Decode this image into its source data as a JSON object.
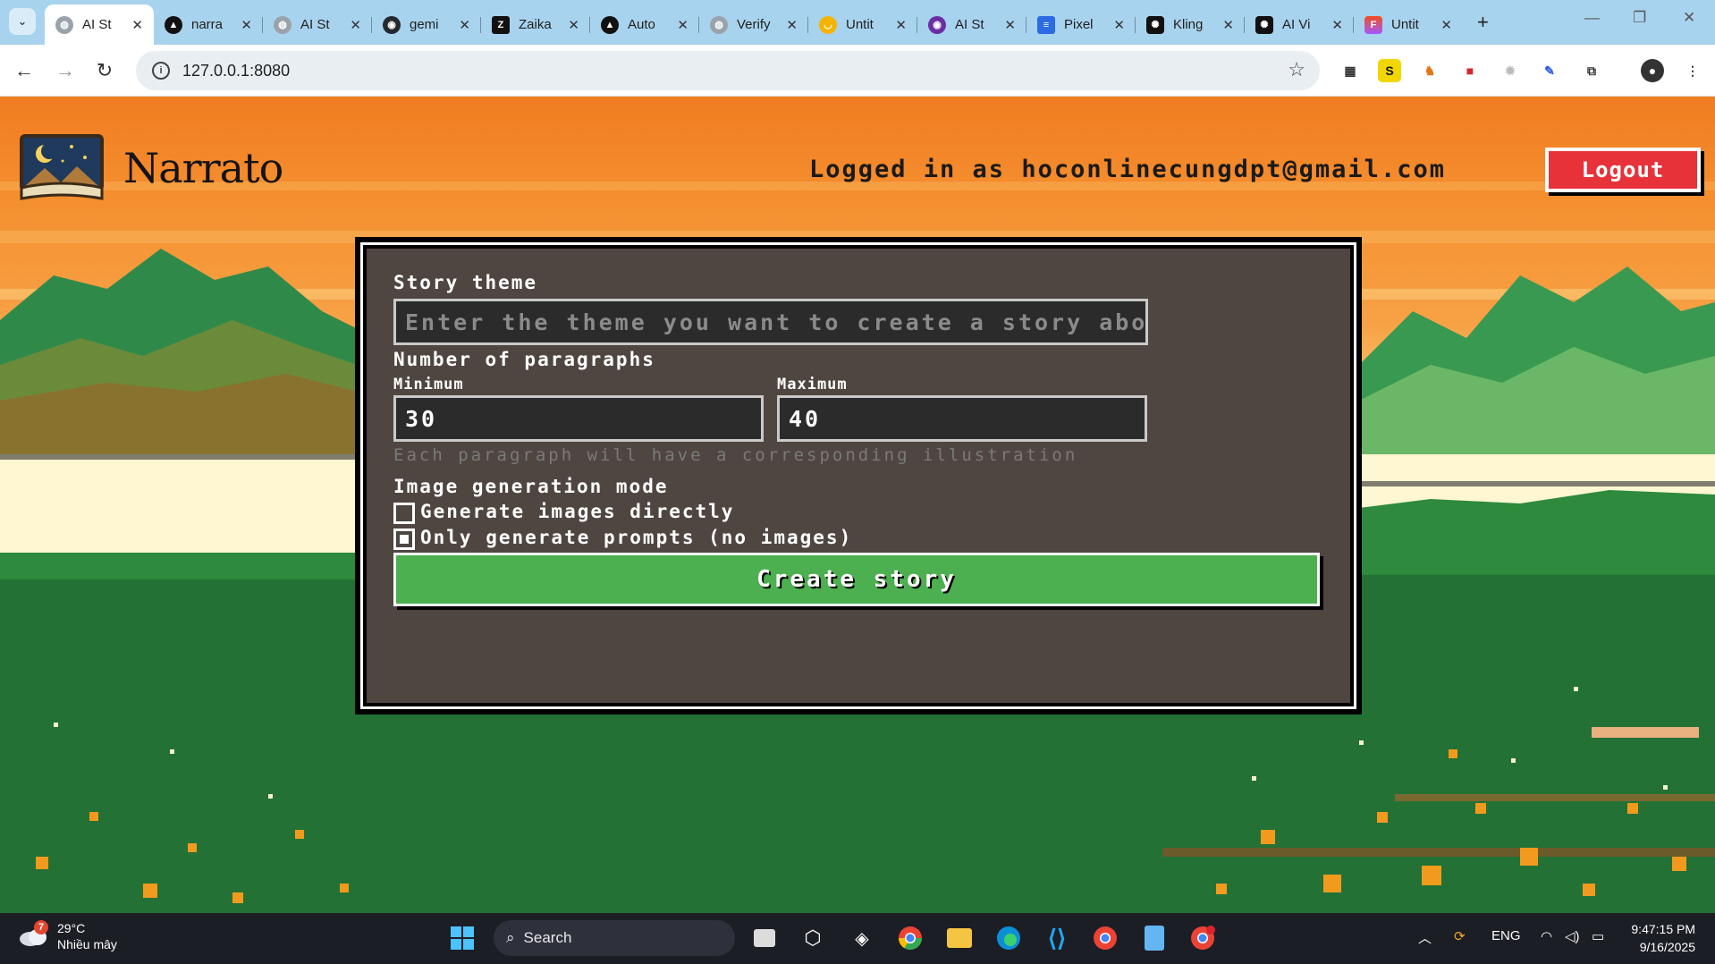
{
  "browser": {
    "tabs": [
      {
        "title": "AI St",
        "active": true
      },
      {
        "title": "narra"
      },
      {
        "title": "AI St"
      },
      {
        "title": "gemi"
      },
      {
        "title": "Zaika"
      },
      {
        "title": "Auto"
      },
      {
        "title": "Verify"
      },
      {
        "title": "Untit"
      },
      {
        "title": "AI St"
      },
      {
        "title": "Pixel"
      },
      {
        "title": "Kling"
      },
      {
        "title": "AI Vi"
      },
      {
        "title": "Untit"
      }
    ],
    "url": "127.0.0.1:8080"
  },
  "app": {
    "brand": "Narrato",
    "logged_in_text": "Logged in as hoconlinecungdpt@gmail.com",
    "logout_label": "Logout",
    "form": {
      "theme_label": "Story theme",
      "theme_placeholder": "Enter the theme you want to create a story about...",
      "paragraphs_label": "Number of paragraphs",
      "min_label": "Minimum",
      "min_value": "30",
      "max_label": "Maximum",
      "max_value": "40",
      "hint": "Each paragraph will have a corresponding illustration",
      "mode_label": "Image generation mode",
      "option_direct": "Generate images directly",
      "option_prompts": "Only generate prompts (no images)",
      "selected_option": "Only generate prompts (no images)",
      "create_label": "Create story"
    }
  },
  "taskbar": {
    "weather_temp": "29°C",
    "weather_desc": "Nhiều mây",
    "weather_badge": "7",
    "search_label": "Search",
    "language": "ENG",
    "time": "9:47:15 PM",
    "date": "9/16/2025"
  },
  "colors": {
    "accent_red": "#e8323a",
    "accent_green": "#4caf50",
    "sky_orange": "#f07c20",
    "tabbar_blue": "#a8d3ee"
  }
}
